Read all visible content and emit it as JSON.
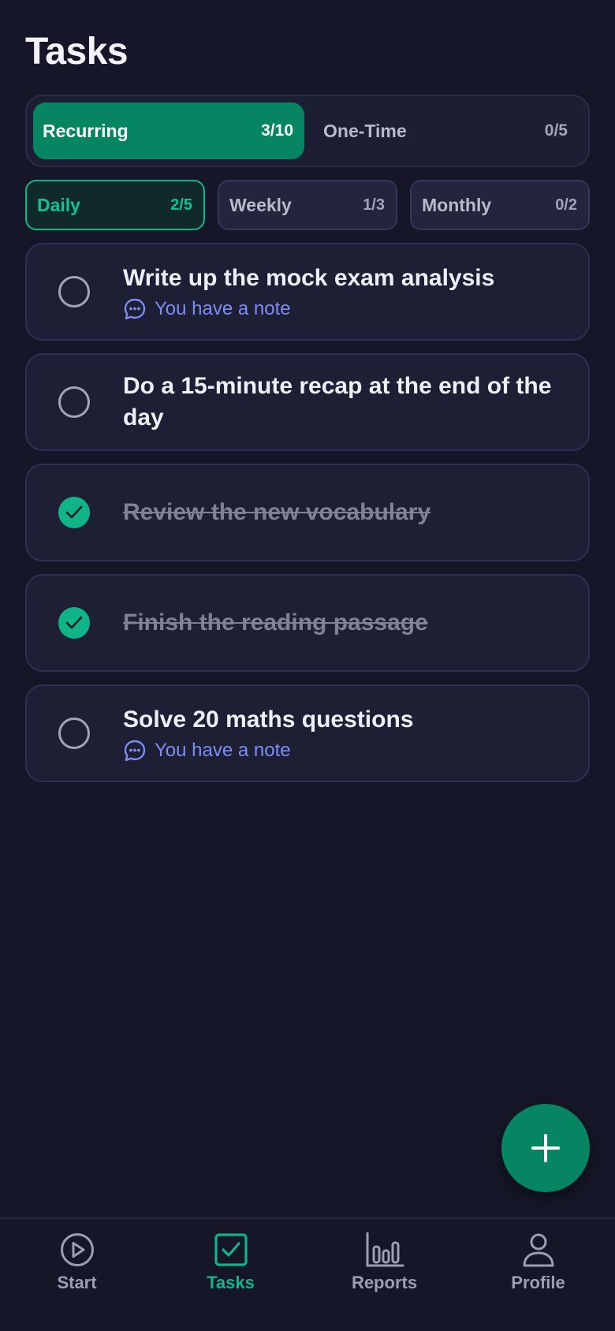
{
  "header": {
    "title": "Tasks"
  },
  "task_type_tabs": [
    {
      "label": "Recurring",
      "count": "3/10",
      "active": true
    },
    {
      "label": "One-Time",
      "count": "0/5",
      "active": false
    }
  ],
  "frequency_tabs": [
    {
      "label": "Daily",
      "count": "2/5",
      "active": true
    },
    {
      "label": "Weekly",
      "count": "1/3",
      "active": false
    },
    {
      "label": "Monthly",
      "count": "0/2",
      "active": false
    }
  ],
  "tasks": [
    {
      "title": "Write up the mock exam analysis",
      "done": false,
      "note": "You have a note"
    },
    {
      "title": "Do a 15-minute recap at the end of the day",
      "done": false
    },
    {
      "title": "Review the new vocabulary",
      "done": true
    },
    {
      "title": "Finish the reading passage",
      "done": true
    },
    {
      "title": "Solve 20 maths questions",
      "done": false,
      "note": "You have a note"
    }
  ],
  "fab": {
    "icon": "plus-icon"
  },
  "bottom_nav": [
    {
      "label": "Start",
      "icon": "play-circle-icon",
      "active": false
    },
    {
      "label": "Tasks",
      "icon": "checkbox-icon",
      "active": true
    },
    {
      "label": "Reports",
      "icon": "bar-chart-icon",
      "active": false
    },
    {
      "label": "Profile",
      "icon": "user-icon",
      "active": false
    }
  ],
  "colors": {
    "background": "#151728",
    "accent": "#058562",
    "accent_text": "#12b48a",
    "note": "#7f8cf2"
  }
}
